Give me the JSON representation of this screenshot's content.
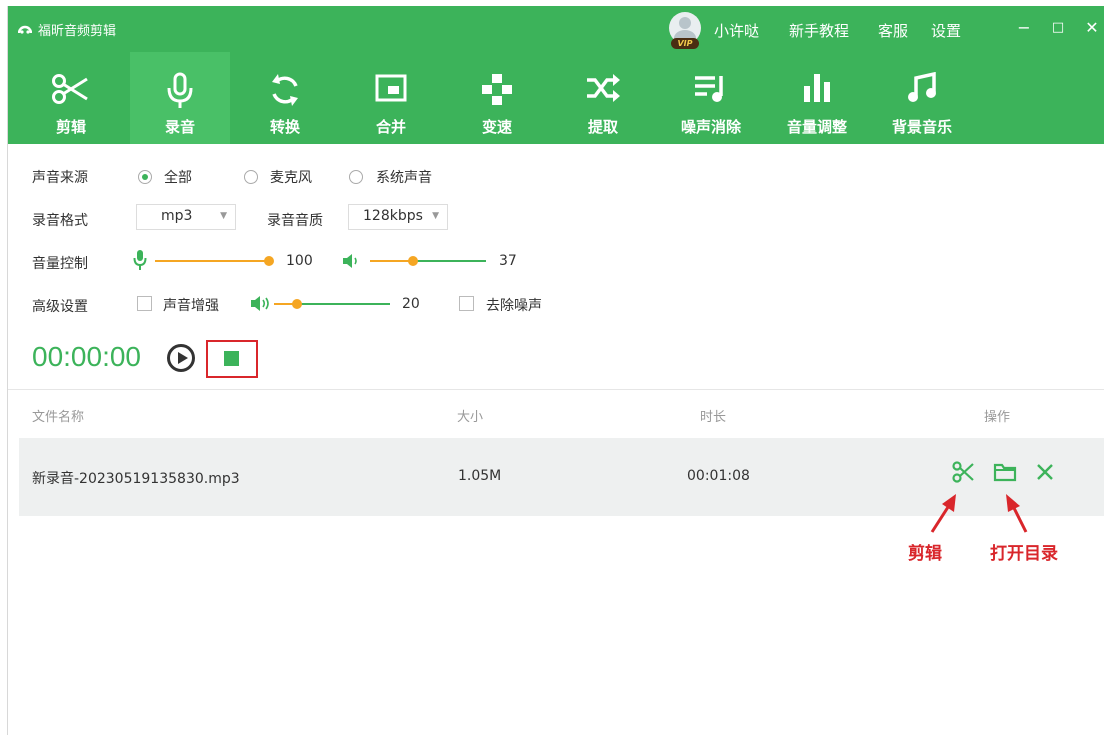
{
  "app": {
    "title": "福昕音频剪辑"
  },
  "header": {
    "user_name": "小许哒",
    "vip_badge": "VIP",
    "links": [
      "新手教程",
      "客服",
      "设置"
    ],
    "window_controls": {
      "minimize": "−",
      "maximize": "□",
      "close": "✕"
    }
  },
  "toolbar": {
    "items": [
      {
        "label": "剪辑",
        "icon": "scissors-icon"
      },
      {
        "label": "录音",
        "icon": "microphone-icon",
        "active": true
      },
      {
        "label": "转换",
        "icon": "convert-icon"
      },
      {
        "label": "合并",
        "icon": "merge-icon"
      },
      {
        "label": "变速",
        "icon": "speed-icon"
      },
      {
        "label": "提取",
        "icon": "extract-icon"
      },
      {
        "label": "噪声消除",
        "icon": "noise-reduction-icon"
      },
      {
        "label": "音量调整",
        "icon": "volume-bars-icon"
      },
      {
        "label": "背景音乐",
        "icon": "music-note-icon"
      }
    ]
  },
  "settings": {
    "source_label": "声音来源",
    "source_options": [
      "全部",
      "麦克风",
      "系统声音"
    ],
    "source_selected": "全部",
    "format_label": "录音格式",
    "format_value": "mp3",
    "quality_label": "录音音质",
    "quality_value": "128kbps",
    "volume_label": "音量控制",
    "mic_volume": "100",
    "system_volume": "37",
    "advanced_label": "高级设置",
    "enhance_label": "声音增强",
    "enhance_checked": false,
    "enhance_value": "20",
    "denoise_label": "去除噪声",
    "denoise_checked": false
  },
  "recorder": {
    "time": "00:00:00"
  },
  "table": {
    "headers": {
      "name": "文件名称",
      "size": "大小",
      "duration": "时长",
      "actions": "操作"
    },
    "rows": [
      {
        "name": "新录音-20230519135830.mp3",
        "size": "1.05M",
        "duration": "00:01:08"
      }
    ]
  },
  "annotations": {
    "cut": "剪辑",
    "open_folder": "打开目录"
  },
  "colors": {
    "brand": "#3cb35a",
    "slider": "#f5a623",
    "highlight": "#d9262b"
  }
}
